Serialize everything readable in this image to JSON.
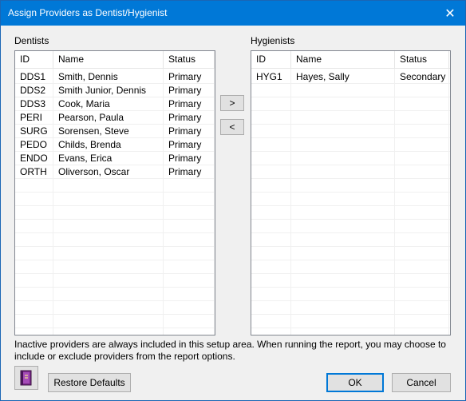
{
  "window": {
    "title": "Assign Providers as Dentist/Hygienist",
    "close_glyph": "✕"
  },
  "dentists": {
    "label": "Dentists",
    "columns": [
      "ID",
      "Name",
      "Status"
    ],
    "rows": [
      [
        "DDS1",
        "Smith, Dennis",
        "Primary"
      ],
      [
        "DDS2",
        "Smith Junior, Dennis",
        "Primary"
      ],
      [
        "DDS3",
        "Cook, Maria",
        "Primary"
      ],
      [
        "PERI",
        "Pearson, Paula",
        "Primary"
      ],
      [
        "SURG",
        "Sorensen, Steve",
        "Primary"
      ],
      [
        "PEDO",
        "Childs, Brenda",
        "Primary"
      ],
      [
        "ENDO",
        "Evans, Erica",
        "Primary"
      ],
      [
        "ORTH",
        "Oliverson, Oscar",
        "Primary"
      ]
    ]
  },
  "hygienists": {
    "label": "Hygienists",
    "columns": [
      "ID",
      "Name",
      "Status"
    ],
    "rows": [
      [
        "HYG1",
        "Hayes, Sally",
        "Secondary"
      ]
    ]
  },
  "move_buttons": {
    "right": ">",
    "left": "<"
  },
  "note": "Inactive providers are always included in this setup area. When running the report, you may choose to include or exclude providers from the report options.",
  "footer": {
    "help_icon": "book-icon",
    "restore_label": "Restore Defaults",
    "ok_label": "OK",
    "cancel_label": "Cancel"
  },
  "colors": {
    "titlebar": "#0078d7",
    "book": "#7a2a8a"
  }
}
